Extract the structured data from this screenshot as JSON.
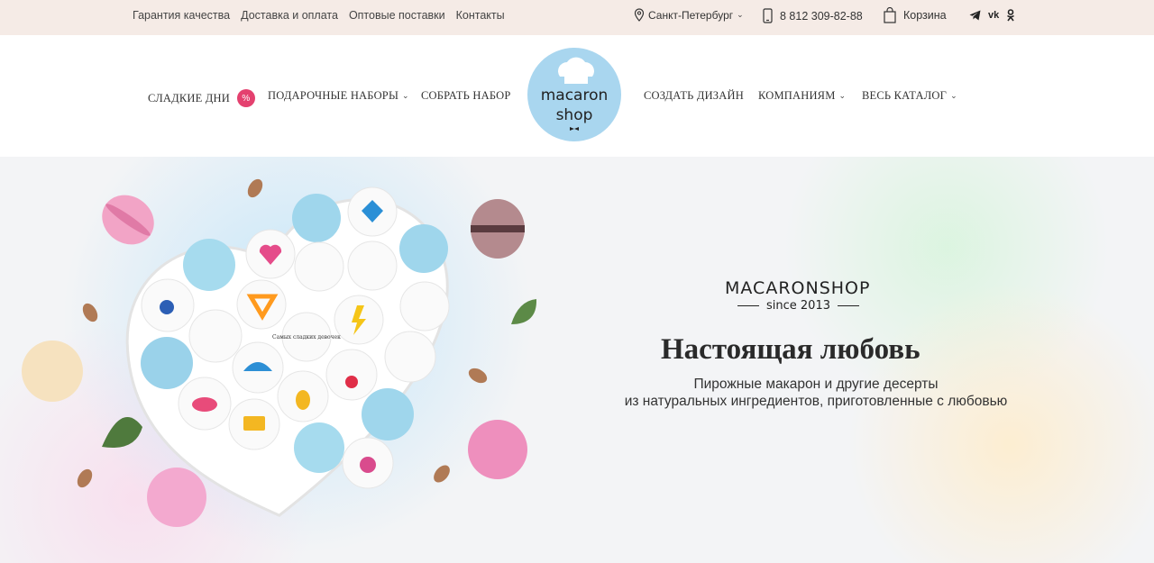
{
  "topbar": {
    "links": [
      "Гарантия качества",
      "Доставка и оплата",
      "Оптовые поставки",
      "Контакты"
    ],
    "city": "Санкт-Петербург",
    "phone": "8 812 309-82-88",
    "cart": "Корзина"
  },
  "nav": {
    "items": [
      {
        "label": "СЛАДКИЕ ДНИ",
        "badge": "%"
      },
      {
        "label": "ПОДАРОЧНЫЕ НАБОРЫ"
      },
      {
        "label": "СОБРАТЬ НАБОР"
      },
      {
        "label": "СОЗДАТЬ ДИЗАЙН"
      },
      {
        "label": "КОМПАНИЯМ"
      },
      {
        "label": "ВЕСЬ КАТАЛОГ"
      }
    ],
    "logo": {
      "line1": "macaron",
      "line2": "shop"
    }
  },
  "hero": {
    "brand": "MACARONSHOP",
    "since": "since 2013",
    "headline": "Настоящая любовь",
    "sub_line1": "Пирожные макарон и другие десерты",
    "sub_line2": "из натуральных ингредиентов, приготовленные с любовью",
    "box_text": "Самых сладких девочек"
  },
  "colors": {
    "topbar_bg": "#f5ebe6",
    "badge": "#e4416f",
    "logo_bg": "#a9d6ef"
  }
}
